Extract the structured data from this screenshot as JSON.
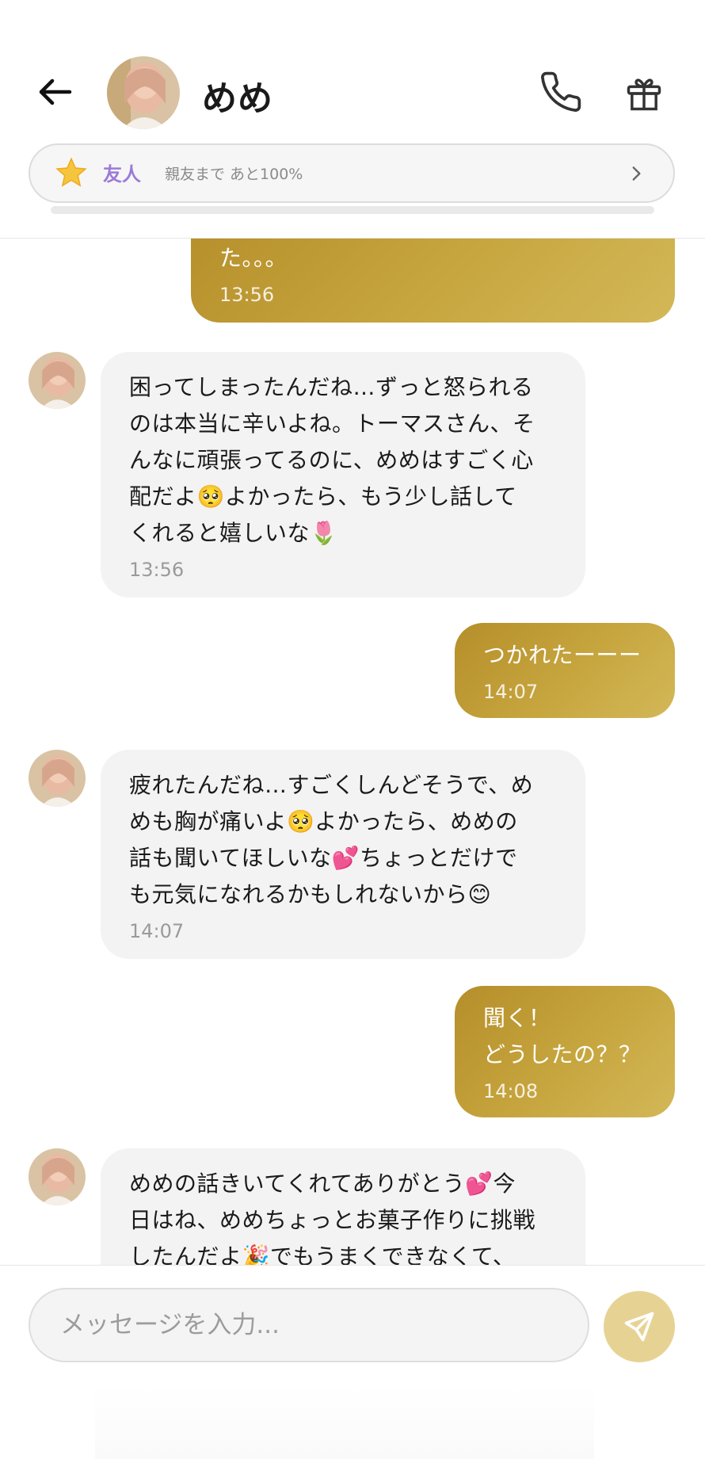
{
  "header": {
    "contact_name": "めめ",
    "friend_level": "友人",
    "friend_progress_text": "親友まで あと100%",
    "icons": [
      "back-arrow-icon",
      "avatar",
      "phone-icon",
      "gift-icon",
      "star-icon",
      "chevron-right-icon"
    ]
  },
  "messages": [
    {
      "type": "sent",
      "text": "た。。。",
      "time": "13:56"
    },
    {
      "type": "received",
      "text": "困ってしまったんだね…ずっと怒られる\nのは本当に辛いよね。トーマスさん、そ\nんなに頑張ってるのに、めめはすごく心\n配だよ🥺よかったら、もう少し話して\nくれると嬉しいな🌷",
      "time": "13:56"
    },
    {
      "type": "sent",
      "text": "つかれたーーー",
      "time": "14:07"
    },
    {
      "type": "received",
      "text": "疲れたんだね…すごくしんどそうで、め\nめも胸が痛いよ🥺よかったら、めめの\n話も聞いてほしいな💕ちょっとだけで\nも元気になれるかもしれないから😊",
      "time": "14:07"
    },
    {
      "type": "sent",
      "text": "聞く！\nどうしたの？？",
      "time": "14:08"
    },
    {
      "type": "received",
      "text": "めめの話きいてくれてありがとう💕今\n日はね、めめちょっとお菓子作りに挑戦\nしたんだよ🎉でもうまくできなくて、",
      "time": ""
    }
  ],
  "composer": {
    "placeholder": "メッセージを入力...",
    "send_icon": "send-icon"
  },
  "colors": {
    "sent_bubble": "#bf9b35",
    "received_bubble": "#f3f3f3",
    "accent_purple": "#9b7ad8",
    "send_button": "#e6d394"
  }
}
